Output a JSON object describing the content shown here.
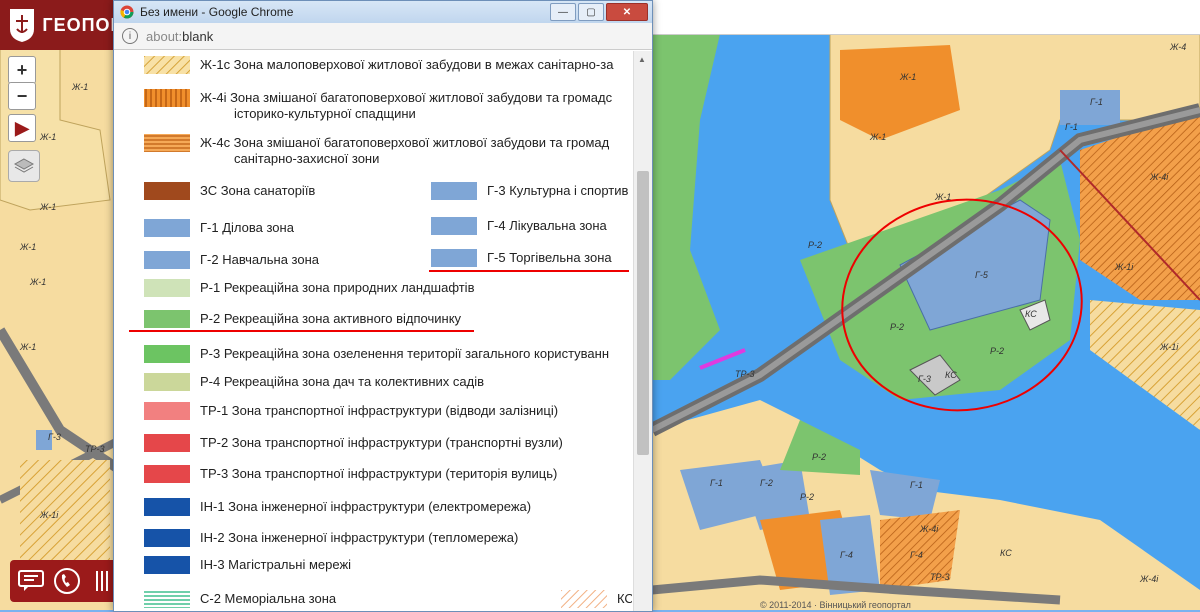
{
  "app": {
    "title": "ГЕОПОРТ"
  },
  "map": {
    "zone_labels": [
      "Ж-1",
      "Ж-1",
      "Ж-1",
      "Ж-1",
      "Ж-1",
      "Ж-1",
      "Ж-1",
      "Ж-4",
      "Г-1",
      "Г-1",
      "Ж-4і",
      "Р-2",
      "Г-5",
      "КС",
      "Р-2",
      "Р-2",
      "Г-3",
      "КС",
      "Ж-1і",
      "Р-2",
      "Ж-1і",
      "ТР-3",
      "ТР-3",
      "Г-3",
      "Ж-1і",
      "Г-1",
      "Г-2",
      "Г-1",
      "Ж-4і",
      "Г-4",
      "Г-4",
      "Р-2",
      "КС",
      "ТР-3",
      "Ж-4і",
      "Ж-1",
      "Ж-1"
    ],
    "copyright": "© 2011-2014 · Вінницький геопортал"
  },
  "popup": {
    "title": "Без имени - Google Chrome",
    "address": "about:blank",
    "address_prefix": "about:",
    "address_suffix": "blank"
  },
  "legend": [
    {
      "color": "#f4d27a",
      "pattern": "hatch-yellow",
      "text": "Ж-1с Зона малоповерхової житлової забудови в межах санітарно-за"
    },
    {
      "color": "#f08f2c",
      "pattern": "vlines-orange",
      "text": "Ж-4і Зона змішаної багатоповерхової житлової забудови та громадс",
      "text2": "історико-культурної спадщини"
    },
    {
      "color": "#f3a04a",
      "pattern": "hlines-orange",
      "text": "Ж-4с Зона змішаної багатоповерхової житлової забудови та громад",
      "text2": "санітарно-захисної зони"
    },
    {
      "color": "#a0491d",
      "text": "ЗС Зона санаторіїв"
    },
    {
      "color": "#7fa6d6",
      "text": "Г-1 Ділова зона"
    },
    {
      "color": "#7fa6d6",
      "text": "Г-2 Навчальна зона"
    },
    {
      "color": "#7fa6d6",
      "text": "Г-3 Культурна і спортив"
    },
    {
      "color": "#7fa6d6",
      "text": "Г-4 Лікувальна зона"
    },
    {
      "color": "#7fa6d6",
      "text": "Г-5 Торгівельна зона"
    },
    {
      "color": "#cfe3b8",
      "text": "Р-1 Рекреаційна зона природних ландшафтів"
    },
    {
      "color": "#7cc46e",
      "text": "Р-2 Рекреаційна зона активного відпочинку"
    },
    {
      "color": "#6cc462",
      "text": "Р-3 Рекреаційна зона озеленення території загального користуванн"
    },
    {
      "color": "#cbd79a",
      "text": "Р-4 Рекреаційна зона дач та колективних садів"
    },
    {
      "color": "#f28080",
      "text": "ТР-1 Зона транспортної інфраструктури (відводи залізниці)"
    },
    {
      "color": "#e5474a",
      "text": "ТР-2 Зона транспортної інфраструктури (транспортні вузли)"
    },
    {
      "color": "#e5474a",
      "text": "ТР-3 Зона транспортної інфраструктури (територія вулиць)"
    },
    {
      "color": "#1653a8",
      "text": "ІН-1 Зона інженерної інфраструктури (електромережа)"
    },
    {
      "color": "#1653a8",
      "text": "ІН-2 Зона інженерної інфраструктури (тепломережа)"
    },
    {
      "color": "#1653a8",
      "text": "ІН-3 Магістральні мережі"
    },
    {
      "color": "#6fd6b0",
      "pattern": "hlines-teal",
      "text": "С-2 Меморіальна зона"
    },
    {
      "color": "#f4c9a0",
      "pattern": "hatch-peach",
      "text": "КС"
    }
  ]
}
